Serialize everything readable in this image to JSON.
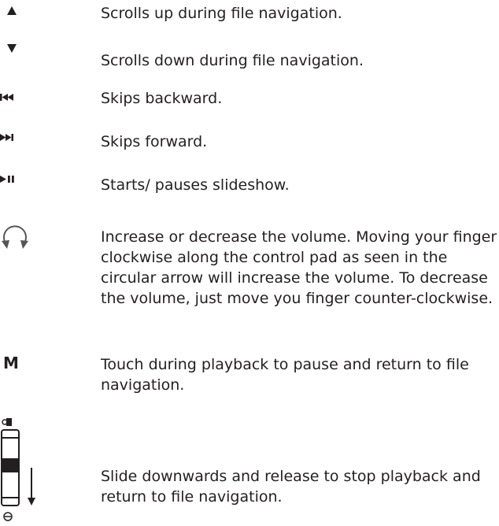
{
  "controls": [
    {
      "icon": "scroll-up-icon",
      "description": "Scrolls up during file navigation."
    },
    {
      "icon": "scroll-down-icon",
      "description": "Scrolls down during file navigation."
    },
    {
      "icon": "skip-backward-icon",
      "description": "Skips backward."
    },
    {
      "icon": "skip-forward-icon",
      "description": "Skips forward."
    },
    {
      "icon": "play-pause-icon",
      "description": "Starts/ pauses slideshow."
    },
    {
      "icon": "circular-arrow-icon",
      "description": "Increase or decrease the volume. Moving your finger clockwise along the control pad as seen in the circular arrow will increase the volume.  To decrease the volume, just move you finger counter-clockwise."
    },
    {
      "icon": "menu-m-icon",
      "label": "M",
      "description": "Touch during playback to pause and return to file navigation."
    },
    {
      "icon": "hold-slider-icon",
      "description": "Slide downwards and release to stop playback and return to file navigation."
    }
  ]
}
